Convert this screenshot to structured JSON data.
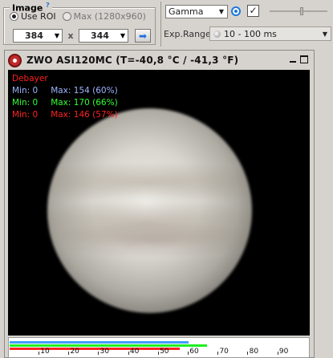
{
  "image_panel": {
    "title": "Image",
    "help_mark": "?",
    "use_roi_label": "Use ROI",
    "max_label": "Max (1280x960)",
    "width_value": "384",
    "height_value": "344",
    "times": "x",
    "go_icon": "arrow-right-icon"
  },
  "controls": {
    "gamma_value": "Gamma",
    "exp_range_label": "Exp.Range",
    "exp_range_value": "10 - 100 ms",
    "check_mark": "✓"
  },
  "camera": {
    "title": "ZWO ASI120MC  (T=-40,8 °C / -41,3 °F)",
    "stats_title": "Debayer",
    "stats": [
      {
        "min": "Min: 0",
        "max": "Max: 154 (60%)",
        "color": "#9db4ff"
      },
      {
        "min": "Min: 0",
        "max": "Max: 170 (66%)",
        "color": "#33ff33"
      },
      {
        "min": "Min: 0",
        "max": "Max: 146 (57%)",
        "color": "#ff2222"
      }
    ],
    "histogram": {
      "ticks": [
        "10",
        "20",
        "30",
        "40",
        "50",
        "60",
        "70",
        "80",
        "90"
      ],
      "levels": {
        "blue": 0.6,
        "green": 0.66,
        "red": 0.57
      },
      "colors": {
        "blue": "#3aa0ff",
        "green": "#22ee22",
        "red": "#ff2222"
      }
    }
  }
}
